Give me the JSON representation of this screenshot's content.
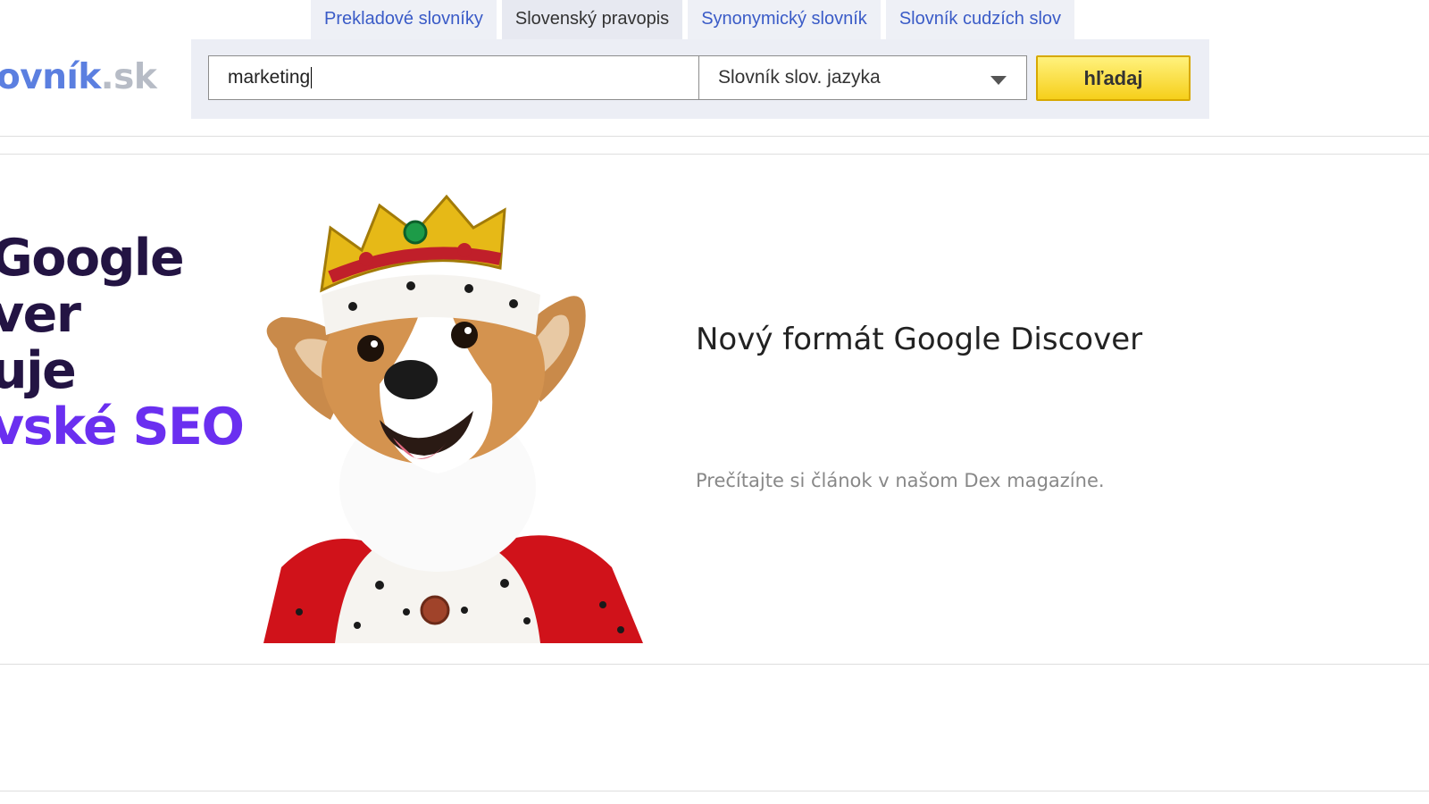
{
  "logo": {
    "part1": "ovník",
    "part2": ".sk"
  },
  "tabs": [
    {
      "label": "Prekladové slovníky",
      "active": false
    },
    {
      "label": "Slovenský pravopis",
      "active": true
    },
    {
      "label": "Synonymický slovník",
      "active": false
    },
    {
      "label": "Slovník cudzích slov",
      "active": false
    }
  ],
  "search": {
    "value": "marketing"
  },
  "dictionary_select": {
    "selected": "Slovník slov. jazyka"
  },
  "search_button": {
    "label": "hľadaj"
  },
  "banner": {
    "headline_lines": [
      "Google",
      "ver",
      "uje"
    ],
    "headline_accent": "vské SEO",
    "title": "Nový formát Google Discover",
    "subtitle": "Prečítajte si článok v našom Dex magazíne."
  },
  "colors": {
    "link": "#3a5bc7",
    "button": "#f6cf1b",
    "accent": "#6a2ff0",
    "headline": "#231443"
  }
}
